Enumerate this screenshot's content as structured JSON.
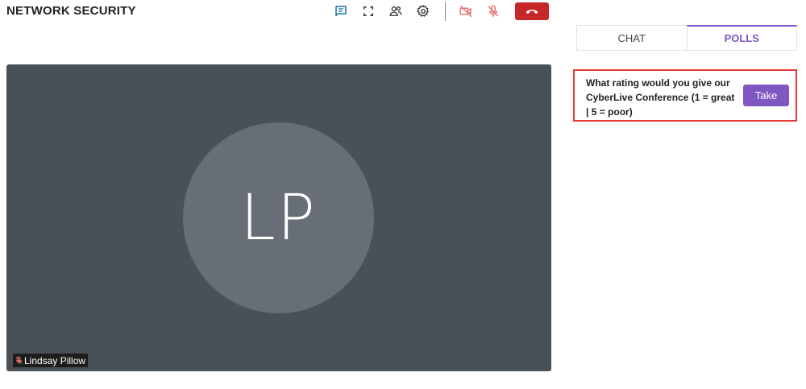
{
  "header": {
    "title": "NETWORK SECURITY",
    "toolbar": [
      {
        "icon": "chat-icon",
        "color": "#1a73a8"
      },
      {
        "icon": "fullscreen-icon",
        "color": "#333333"
      },
      {
        "icon": "participants-icon",
        "color": "#333333"
      },
      {
        "icon": "settings-icon",
        "color": "#333333"
      },
      {
        "icon": "camera-off-icon",
        "color": "#e57373"
      },
      {
        "icon": "mic-off-icon",
        "color": "#e57373"
      }
    ],
    "end_call": {
      "icon": "end-call-icon",
      "color": "#c62828"
    }
  },
  "video": {
    "initials": "LP",
    "participant_name": "Lindsay Pillow",
    "muted": true
  },
  "sidebar": {
    "tabs": [
      {
        "label": "CHAT",
        "active": false
      },
      {
        "label": "POLLS",
        "active": true
      }
    ],
    "poll": {
      "question": "What rating would you give our CyberLive Conference (1 = great | 5 = poor)",
      "button_label": "Take"
    }
  },
  "colors": {
    "accent": "#7e57c2",
    "highlight_border": "#e53935",
    "video_bg": "#4a5058",
    "avatar_bg": "#686e75"
  }
}
